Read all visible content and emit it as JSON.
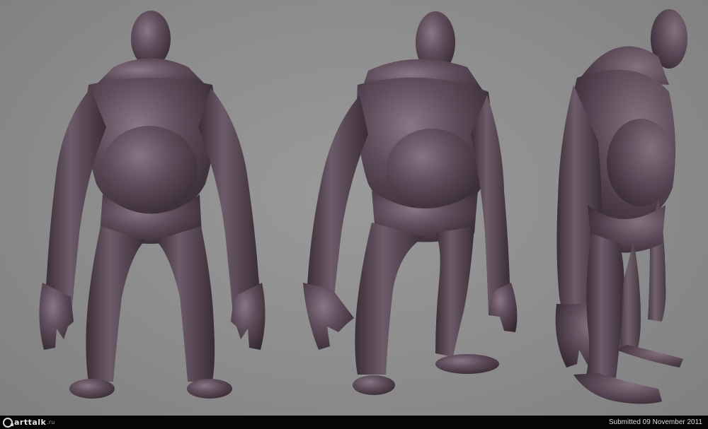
{
  "image": {
    "subject": "three-view sculpt render",
    "colors": {
      "background": "#8c8c8c",
      "clay": "#5c4a58",
      "clay_light": "#7d6a79",
      "clay_dark": "#3a2d37",
      "footer_bar": "#050505",
      "footer_text": "#dcdcdc"
    },
    "views": [
      {
        "name": "front"
      },
      {
        "name": "three-quarter"
      },
      {
        "name": "side"
      }
    ]
  },
  "footer": {
    "logo_text": "arttalk",
    "logo_suffix": ".ru",
    "submitted": "Submitted 09 November 2011"
  }
}
